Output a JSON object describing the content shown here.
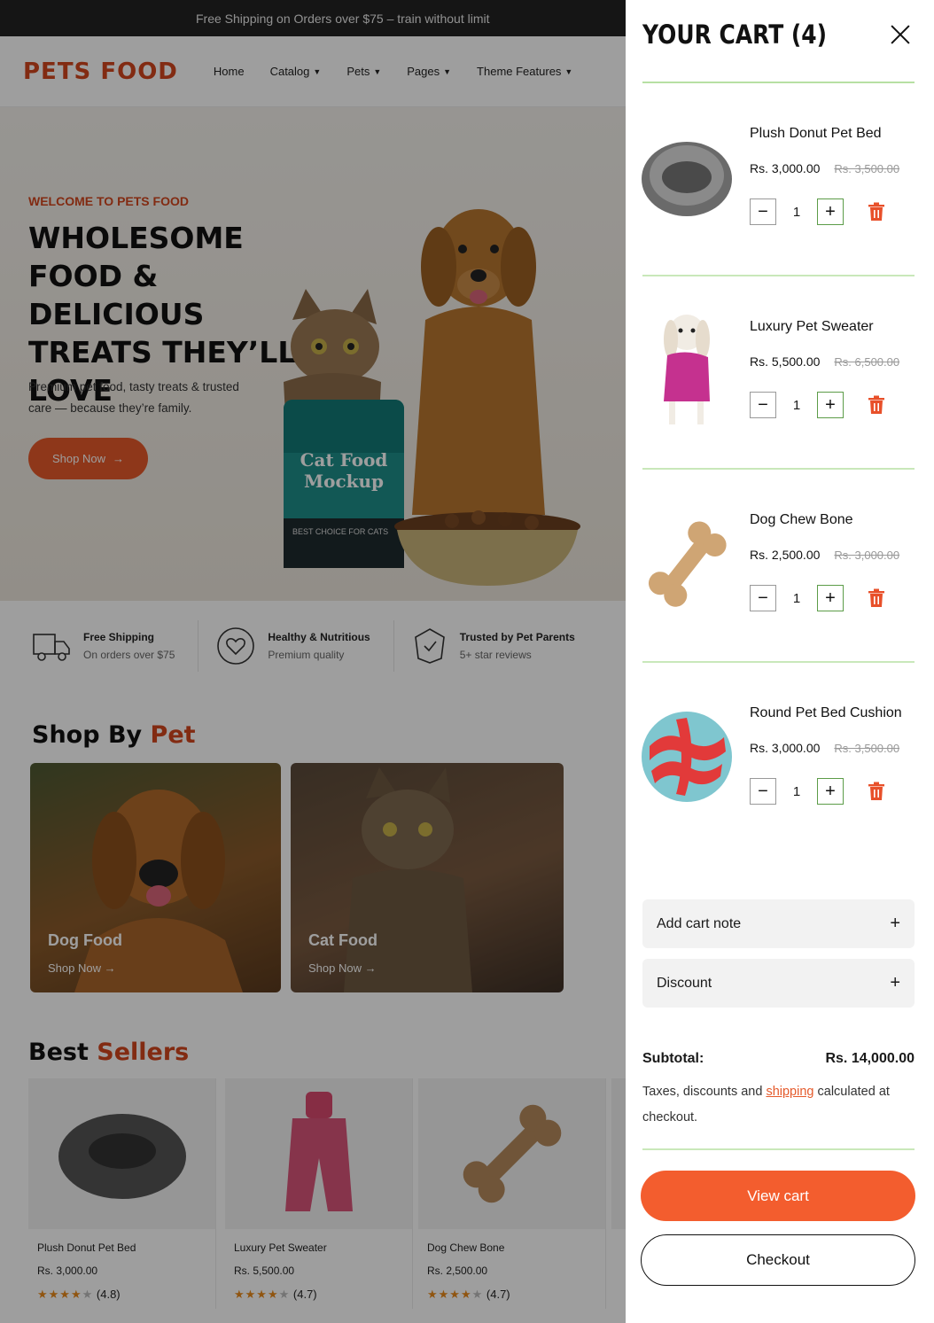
{
  "announcement": "Free Shipping on Orders over $75 – train without limit",
  "logo": "PETS FOOD",
  "nav": [
    {
      "label": "Home",
      "dropdown": false
    },
    {
      "label": "Catalog",
      "dropdown": true
    },
    {
      "label": "Pets",
      "dropdown": true
    },
    {
      "label": "Pages",
      "dropdown": true
    },
    {
      "label": "Theme Features",
      "dropdown": true
    }
  ],
  "hero": {
    "subtitle": "WELCOME TO PETS FOOD",
    "title": "WHOLESOME FOOD & DELICIOUS TREATS THEY’LL LOVE",
    "desc": "Premium pet food, tasty treats & trusted care — because they’re family.",
    "button": "Shop Now",
    "bag_text": "Cat Food Mockup",
    "bag_tag": "BEST CHOICE FOR CATS"
  },
  "features": [
    {
      "title": "Free Shipping",
      "sub": "On orders over $75",
      "icon": "truck-icon"
    },
    {
      "title": "Healthy & Nutritious",
      "sub": "Premium quality",
      "icon": "heart-icon"
    },
    {
      "title": "Trusted by Pet Parents",
      "sub": "5+ star reviews",
      "icon": "badge-icon"
    }
  ],
  "shop_by_pet": {
    "title_main": "Shop By",
    "title_accent": "Pet",
    "cards": [
      {
        "title": "Dog Food",
        "link": "Shop Now"
      },
      {
        "title": "Cat Food",
        "link": "Shop Now"
      }
    ]
  },
  "best_sellers": {
    "title_main": "Best",
    "title_accent": "Sellers",
    "items": [
      {
        "name": "Plush Donut Pet Bed",
        "price": "Rs. 3,000.00",
        "rating": "(4.8)",
        "stars": 4.8
      },
      {
        "name": "Luxury Pet Sweater",
        "price": "Rs. 5,500.00",
        "rating": "(4.7)",
        "stars": 4.7
      },
      {
        "name": "Dog Chew Bone",
        "price": "Rs. 2,500.00",
        "rating": "(4.7)",
        "stars": 4.7
      }
    ]
  },
  "cart": {
    "title": "YOUR CART (4)",
    "items": [
      {
        "name": "Plush Donut Pet Bed",
        "price": "Rs. 3,000.00",
        "compare": "Rs. 3,500.00",
        "qty": "1",
        "image": "donut-bed-image"
      },
      {
        "name": "Luxury Pet Sweater",
        "price": "Rs. 5,500.00",
        "compare": "Rs. 6,500.00",
        "qty": "1",
        "image": "sweater-dog-image"
      },
      {
        "name": "Dog Chew Bone",
        "price": "Rs. 2,500.00",
        "compare": "Rs. 3,000.00",
        "qty": "1",
        "image": "chew-bone-image"
      },
      {
        "name": "Round Pet Bed Cushion",
        "price": "Rs. 3,000.00",
        "compare": "Rs. 3,500.00",
        "qty": "1",
        "image": "round-cushion-image"
      }
    ],
    "note_label": "Add cart note",
    "discount_label": "Discount",
    "subtotal_label": "Subtotal:",
    "subtotal_value": "Rs. 14,000.00",
    "tax_prefix": "Taxes, discounts and",
    "tax_link": "shipping",
    "tax_suffix": "calculated at checkout.",
    "view_cart": "View cart",
    "checkout": "Checkout"
  },
  "colors": {
    "brand": "#d2461e",
    "button": "#f35d2e",
    "divider": "#c9e8ba",
    "trash": "#e8502a"
  }
}
